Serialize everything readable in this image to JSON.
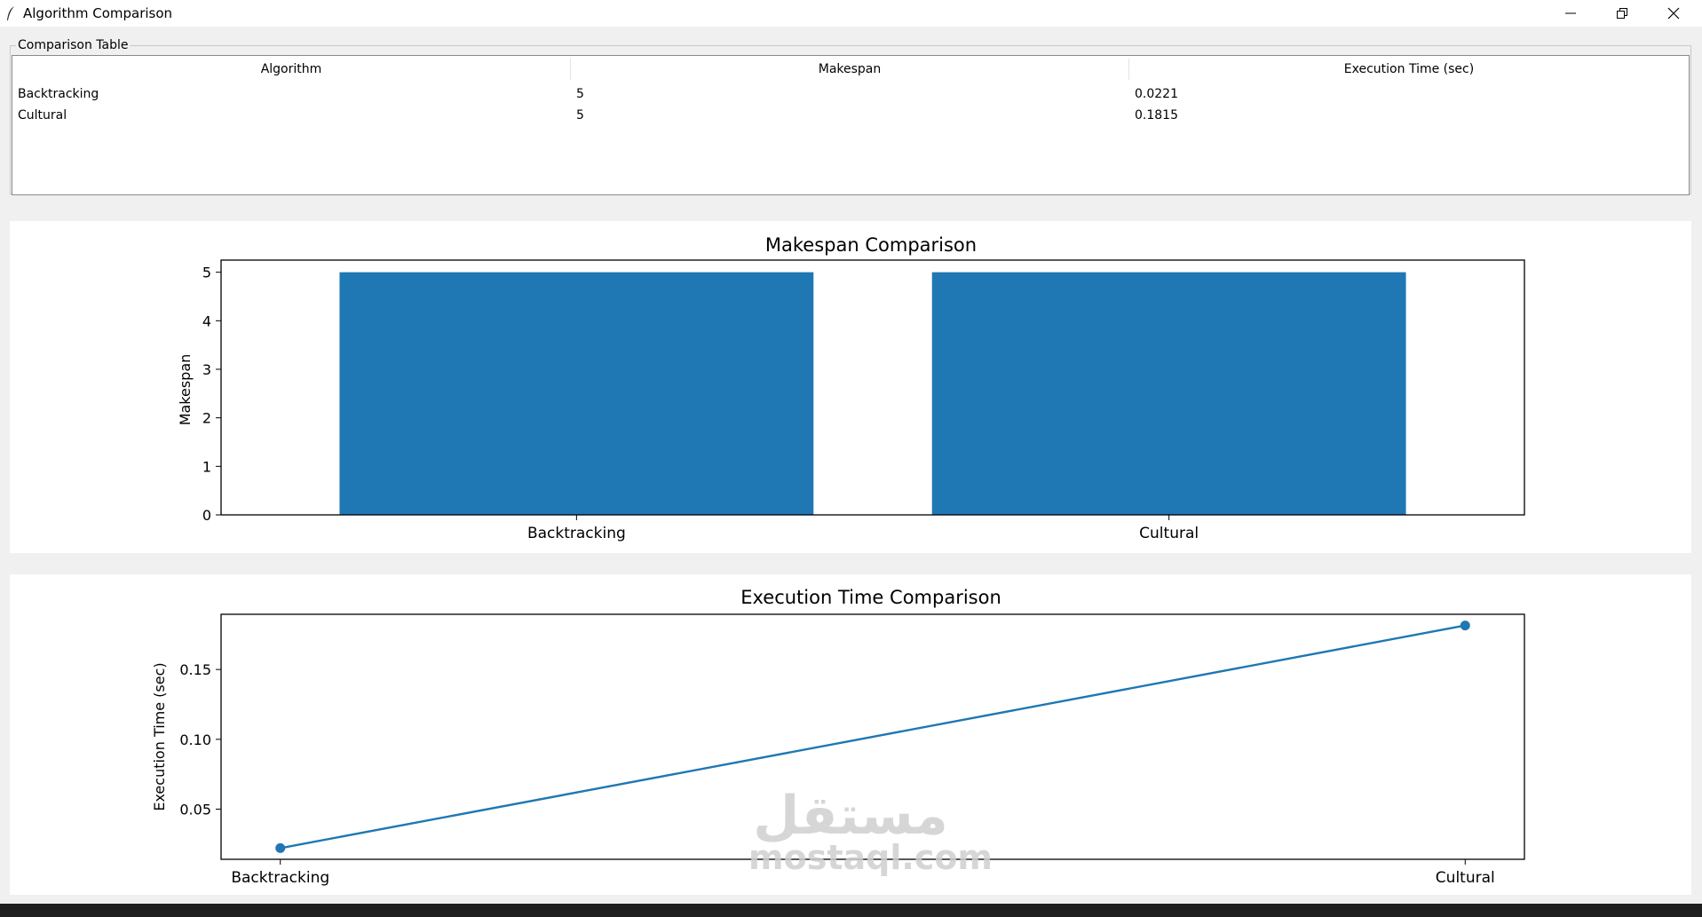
{
  "window": {
    "title": "Algorithm Comparison",
    "controls": [
      "minimize",
      "restore",
      "close"
    ]
  },
  "table": {
    "group_label": "Comparison Table",
    "columns": [
      "Algorithm",
      "Makespan",
      "Execution Time (sec)"
    ],
    "rows": [
      [
        "Backtracking",
        "5",
        "0.0221"
      ],
      [
        "Cultural",
        "5",
        "0.1815"
      ]
    ]
  },
  "chart_data": [
    {
      "type": "bar",
      "title": "Makespan Comparison",
      "xlabel": "",
      "ylabel": "Makespan",
      "categories": [
        "Backtracking",
        "Cultural"
      ],
      "values": [
        5,
        5
      ],
      "ylim": [
        0,
        5.25
      ],
      "yticks": [
        0,
        1,
        2,
        3,
        4,
        5
      ],
      "grid": false,
      "color": "#1f77b4"
    },
    {
      "type": "line",
      "title": "Execution Time Comparison",
      "xlabel": "",
      "ylabel": "Execution Time (sec)",
      "categories": [
        "Backtracking",
        "Cultural"
      ],
      "values": [
        0.0221,
        0.1815
      ],
      "ylim": [
        0.0141,
        0.1895
      ],
      "yticks": [
        0.05,
        0.1,
        0.15
      ],
      "ytick_labels": [
        "0.05",
        "0.10",
        "0.15"
      ],
      "marker": "circle",
      "grid": false,
      "color": "#1f77b4"
    }
  ],
  "watermark": {
    "arabic": "مستقل",
    "latin": "mostaql.com"
  }
}
